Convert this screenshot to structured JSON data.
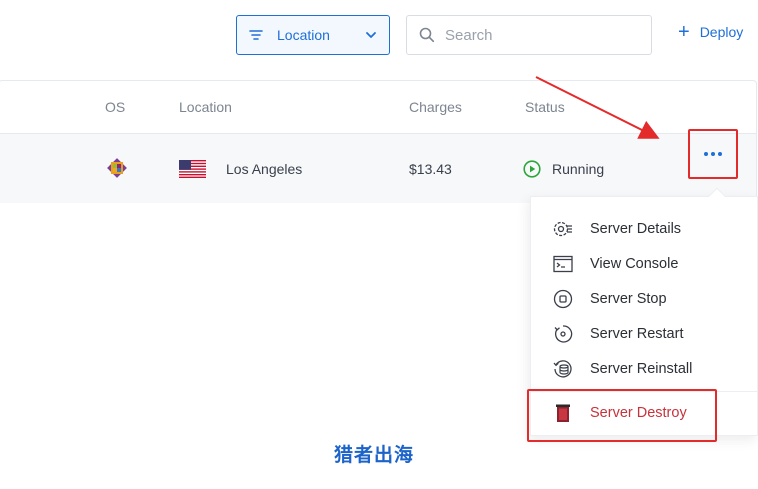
{
  "toolbar": {
    "location_filter_label": "Location",
    "search_placeholder": "Search",
    "deploy_label": "Deploy"
  },
  "table": {
    "headers": {
      "os": "OS",
      "location": "Location",
      "charges": "Charges",
      "status": "Status"
    },
    "row": {
      "os_icon": "os-logo-icon",
      "location": "Los Angeles",
      "flag": "us-flag-icon",
      "charges": "$13.43",
      "status": "Running",
      "status_color": "#2aa63a"
    }
  },
  "menu": {
    "items": [
      {
        "label": "Server Details",
        "icon": "server-details-icon"
      },
      {
        "label": "View Console",
        "icon": "console-icon"
      },
      {
        "label": "Server Stop",
        "icon": "stop-icon"
      },
      {
        "label": "Server Restart",
        "icon": "restart-icon"
      },
      {
        "label": "Server Reinstall",
        "icon": "reinstall-icon"
      }
    ],
    "destroy": {
      "label": "Server Destroy",
      "icon": "trash-icon",
      "color": "#c6333a"
    }
  },
  "watermark": "猎者出海",
  "colors": {
    "accent": "#1e6fd6",
    "annotation": "#e32b2b"
  }
}
